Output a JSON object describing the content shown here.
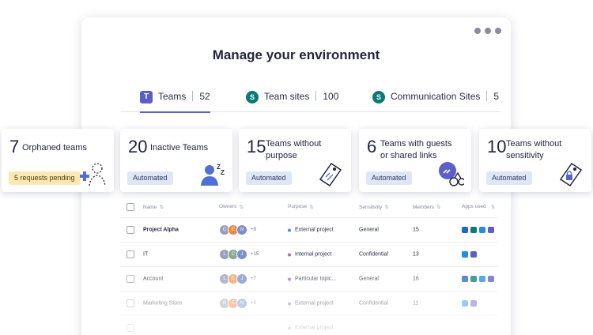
{
  "window": {
    "title": "Manage your environment"
  },
  "tabs": [
    {
      "label": "Teams",
      "count": "52",
      "icon": "teams-icon"
    },
    {
      "label": "Team sites",
      "count": "100",
      "icon": "sharepoint-icon"
    },
    {
      "label": "Communication Sites",
      "count": "5",
      "icon": "sharepoint-icon"
    }
  ],
  "cards": [
    {
      "number": "7",
      "label": "Orphaned teams",
      "badge": "5 requests pending",
      "icon": "add-owner-icon"
    },
    {
      "number": "20",
      "label": "Inactive Teams",
      "badge": "Automated",
      "icon": "sleeping-user-icon"
    },
    {
      "number": "15",
      "label": "Teams without purpose",
      "badge": "Automated",
      "icon": "tag-icon"
    },
    {
      "number": "6",
      "label": "Teams with guests or shared links",
      "badge": "Automated",
      "icon": "guest-link-icon"
    },
    {
      "number": "10",
      "label": "Teams without sensitivity",
      "badge": "Automated",
      "icon": "lock-tag-icon"
    }
  ],
  "table": {
    "headers": {
      "name": "Name",
      "owners": "Owners",
      "purpose": "Purpose",
      "sensitivity": "Sensitivity",
      "members": "Members",
      "apps": "Apps used"
    },
    "rows": [
      {
        "name": "Project Alpha",
        "owners": [
          "C",
          "E",
          "N"
        ],
        "owner_colors": [
          "#9aa0b8",
          "#f0873e",
          "#7b8fc9"
        ],
        "more": "+9",
        "purpose": "External project",
        "purpose_color": "#4f8fd8",
        "sensitivity": "General",
        "members": "15"
      },
      {
        "name": "IT",
        "owners": [
          "L",
          "C",
          "J"
        ],
        "owner_colors": [
          "#9aa0b8",
          "#8aa890",
          "#7b8fc9"
        ],
        "more": "+15",
        "purpose": "Internal project",
        "purpose_color": "#a36bd1",
        "sensitivity": "Confidential",
        "members": "13"
      },
      {
        "name": "Account",
        "owners": [
          "L",
          "E",
          "J"
        ],
        "owner_colors": [
          "#9aa0b8",
          "#f0a060",
          "#7b8fc9"
        ],
        "more": "+7",
        "purpose": "Particular topic...",
        "purpose_color": "#a36bd1",
        "sensitivity": "General",
        "members": "16"
      },
      {
        "name": "Marketing Store",
        "owners": [
          "R",
          "E",
          "N"
        ],
        "owner_colors": [
          "#9aa0b8",
          "#f0873e",
          "#7b8fc9"
        ],
        "more": "+3",
        "purpose": "External project",
        "purpose_color": "#4f8fd8",
        "sensitivity": "Confidential",
        "members": "11"
      },
      {
        "name": "",
        "owners": [],
        "owner_colors": [],
        "more": "",
        "purpose": "External project",
        "purpose_color": "#4f8fd8",
        "sensitivity": "",
        "members": ""
      }
    ]
  },
  "colors": {
    "accent": "#5b5fc7",
    "badge_automated": "#dde7f6",
    "badge_pending": "#fce8b2"
  }
}
